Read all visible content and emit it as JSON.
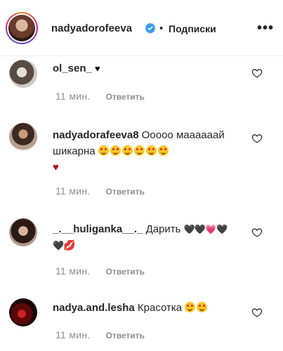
{
  "header": {
    "username": "nadyadorofeeva",
    "dot": "•",
    "follow_label": "Подписки",
    "more": "•••"
  },
  "comments": [
    {
      "username": "ol_sen_",
      "text": "♥",
      "time": "11 мин.",
      "reply": "Ответить"
    },
    {
      "username": "nadyadorafeeva8",
      "text": "Ооооо маааааай шикарна",
      "emojis": [
        "smile-heart-eyes",
        "smile-heart-eyes",
        "smile-heart-eyes",
        "smile-heart-eyes",
        "smile-heart-eyes",
        "smile-heart-eyes",
        "red-heart"
      ],
      "time": "11 мин.",
      "reply": "Ответить"
    },
    {
      "username": "_.__huliganka__._",
      "text": "Дарить",
      "hearts_line1": "🖤🖤",
      "heart_pink": "💗",
      "heart_end": "🖤",
      "heart_line2": "🖤",
      "lips": "💋",
      "time": "11 мин.",
      "reply": "Ответить"
    },
    {
      "username": "nadya.and.lesha",
      "text": "Красотка",
      "emojis": [
        "smile-heart-eyes",
        "smile-heart-eyes"
      ],
      "time": "11 мин.",
      "reply": "Ответить"
    }
  ],
  "icons": {
    "like": "heart-outline-icon",
    "verified": "verified-badge-icon"
  },
  "colors": {
    "text": "#262626",
    "meta": "#8e8e8e",
    "verified": "#3897f0",
    "heart_red": "#b01515"
  }
}
